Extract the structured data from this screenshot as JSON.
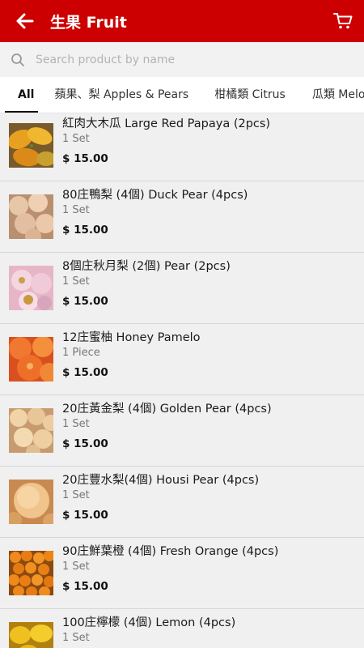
{
  "header": {
    "title": "生果 Fruit",
    "back_icon": "arrow-left-icon",
    "cart_icon": "cart-icon",
    "color": "#cc0000"
  },
  "search": {
    "placeholder": "Search product by name",
    "icon": "search-icon"
  },
  "tabs": [
    {
      "label": "All",
      "active": true
    },
    {
      "label": "蘋果、梨 Apples & Pears",
      "active": false
    },
    {
      "label": "柑橘類 Citrus",
      "active": false
    },
    {
      "label": "瓜類 Melons",
      "active": false
    }
  ],
  "products": [
    {
      "name": "紅肉大木瓜 Large Red Papaya (2pcs)",
      "unit": "1 Set",
      "price": "$ 15.00",
      "image": "papaya"
    },
    {
      "name": "80庄鴨梨 (4個) Duck Pear (4pcs)",
      "unit": "1 Set",
      "price": "$ 15.00",
      "image": "duck-pear"
    },
    {
      "name": "8個庄秋月梨 (2個) Pear (2pcs)",
      "unit": "1 Set",
      "price": "$ 15.00",
      "image": "autumn-pear"
    },
    {
      "name": "12庄蜜柚 Honey Pamelo",
      "unit": "1 Piece",
      "price": "$ 15.00",
      "image": "pomelo"
    },
    {
      "name": "20庄黃金梨 (4個) Golden Pear (4pcs)",
      "unit": "1 Set",
      "price": "$ 15.00",
      "image": "golden-pear"
    },
    {
      "name": "20庄豐水梨(4個) Housi Pear (4pcs)",
      "unit": "1 Set",
      "price": "$ 15.00",
      "image": "housi-pear"
    },
    {
      "name": "90庄鮮葉橙 (4個) Fresh Orange (4pcs)",
      "unit": "1 Set",
      "price": "$ 15.00",
      "image": "orange"
    },
    {
      "name": "100庄檸檬 (4個) Lemon (4pcs)",
      "unit": "1 Set",
      "price": "",
      "image": "lemon"
    }
  ]
}
